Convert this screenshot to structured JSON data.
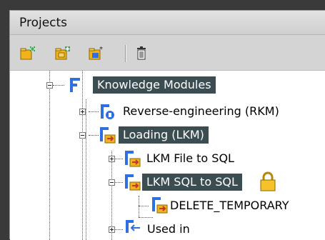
{
  "panel": {
    "title": "Projects"
  },
  "toolbar": {
    "buttons": [
      {
        "icon": "new-folder-icon"
      },
      {
        "icon": "new-subfolder-icon"
      },
      {
        "icon": "new-item-icon"
      },
      {
        "icon": "trash-icon"
      }
    ]
  },
  "tree": {
    "nodes": [
      {
        "label": "Knowledge Modules",
        "selected": true,
        "expander": "minus"
      },
      {
        "label": "Reverse-engineering (RKM)",
        "selected": false,
        "expander": "plus"
      },
      {
        "label": "Loading (LKM)",
        "selected": true,
        "expander": "minus"
      },
      {
        "label": "LKM File to SQL",
        "selected": false,
        "expander": "plus"
      },
      {
        "label": "LKM SQL to SQL",
        "selected": true,
        "expander": "minus",
        "locked": true
      },
      {
        "label": "DELETE_TEMPORARY",
        "selected": false
      },
      {
        "label": "Used in",
        "selected": false,
        "expander": "plus"
      }
    ]
  },
  "colors": {
    "selection": "#3c4d52",
    "folder": "#f2b21b",
    "accent": "#2f6fe0"
  }
}
